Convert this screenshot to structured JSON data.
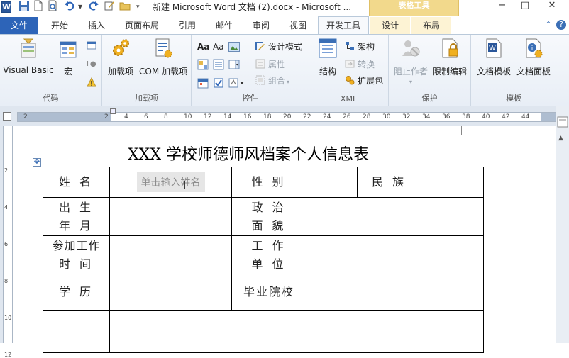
{
  "app": {
    "icon_letter": "W",
    "title": "新建 Microsoft Word 文档 (2).docx - Microsoft ...",
    "context_tab_title": "表格工具",
    "window_controls": [
      "−",
      "□",
      "✕"
    ]
  },
  "tabs": {
    "file": "文件",
    "items": [
      "开始",
      "插入",
      "页面布局",
      "引用",
      "邮件",
      "审阅",
      "视图",
      "开发工具"
    ],
    "active": "开发工具",
    "context_items": [
      "设计",
      "布局"
    ]
  },
  "ribbon": {
    "code": {
      "label": "代码",
      "visual_basic": "Visual Basic",
      "macro": "宏"
    },
    "addins": {
      "label": "加载项",
      "addin": "加载项",
      "com_addin": "COM 加载项"
    },
    "controls": {
      "label": "控件",
      "design_mode": "设计模式",
      "properties": "属性",
      "group": "组合"
    },
    "xml": {
      "label": "XML",
      "structure": "结构",
      "schema": "架构",
      "transform": "转换",
      "expansion_pack": "扩展包"
    },
    "protect": {
      "label": "保护",
      "block_authors": "阻止作者",
      "restrict_editing": "限制编辑"
    },
    "templates": {
      "label": "模板",
      "doc_template": "文档模板",
      "doc_panel": "文档面板"
    }
  },
  "ruler": {
    "h_numbers": [
      "2",
      "2",
      "4",
      "6",
      "8",
      "10",
      "12",
      "14",
      "16",
      "18",
      "20",
      "22",
      "24",
      "26",
      "28",
      "30",
      "32",
      "34",
      "36",
      "38",
      "40",
      "42",
      "44"
    ],
    "v_numbers": [
      "2",
      "4",
      "6",
      "8",
      "10",
      "12"
    ]
  },
  "document": {
    "title": "XXX 学校师德师风档案个人信息表",
    "placeholder": "单击输入姓名",
    "rows": [
      {
        "l1": "姓 名",
        "l2": "性 别",
        "l3": "民 族"
      },
      {
        "l1a": "出 生",
        "l1b": "年 月",
        "l2a": "政 治",
        "l2b": "面 貌"
      },
      {
        "l1a": "参加工作",
        "l1b": "时 间",
        "l2a": "工 作",
        "l2b": "单 位"
      },
      {
        "l1": "学 历",
        "l2": "毕业院校"
      }
    ]
  }
}
